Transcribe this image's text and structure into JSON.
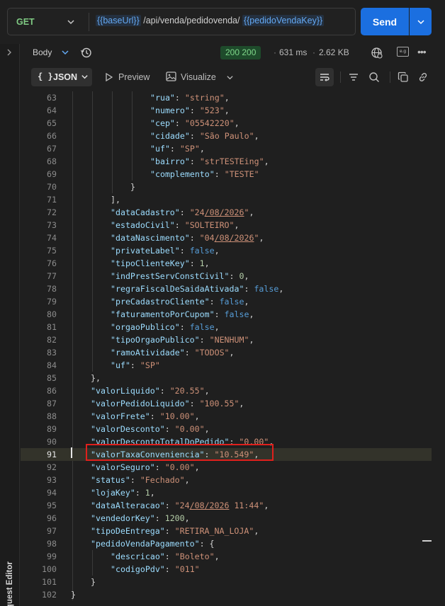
{
  "request": {
    "method": "GET",
    "url_parts": [
      {
        "text": "{{baseUrl}}",
        "type": "var"
      },
      {
        "text": " /api/venda/pedidovenda/ ",
        "type": "plain"
      },
      {
        "text": "{{pedidoVendaKey}}",
        "type": "var"
      }
    ],
    "send_label": "Send"
  },
  "sidebar": {
    "request_editor_label": "Request Editor"
  },
  "response": {
    "body_tab_label": "Body",
    "status": "200 200",
    "time": "631 ms",
    "size": "2.62 KB",
    "example_icon_text": "e.g"
  },
  "toolbar": {
    "json_brace": "{ }",
    "json_label": "JSON",
    "preview_label": "Preview",
    "visualize_label": "Visualize"
  },
  "colors": {
    "send_button": "#1b6fe0",
    "status_badge_bg": "#1e4b2b",
    "status_badge_text": "#7fd78a",
    "highlight_border": "#e0201c",
    "method": "#7fca83",
    "variable": "#64a9f4"
  },
  "icons": [
    "chevron-down-icon",
    "history-icon",
    "globe-icon",
    "example-icon",
    "more-icon",
    "play-icon",
    "image-icon",
    "wrap-icon",
    "filter-icon",
    "search-icon",
    "copy-icon",
    "link-icon",
    "chevron-right-icon"
  ],
  "code": {
    "highlighted_line": 91,
    "lines": [
      {
        "n": 63,
        "ind": 16,
        "t": [
          [
            "k",
            "\"rua\""
          ],
          [
            "p",
            ": "
          ],
          [
            "s",
            "\"string\""
          ],
          [
            "p",
            ","
          ]
        ]
      },
      {
        "n": 64,
        "ind": 16,
        "t": [
          [
            "k",
            "\"numero\""
          ],
          [
            "p",
            ": "
          ],
          [
            "s",
            "\"523\""
          ],
          [
            "p",
            ","
          ]
        ]
      },
      {
        "n": 65,
        "ind": 16,
        "t": [
          [
            "k",
            "\"cep\""
          ],
          [
            "p",
            ": "
          ],
          [
            "s",
            "\"05542220\""
          ],
          [
            "p",
            ","
          ]
        ]
      },
      {
        "n": 66,
        "ind": 16,
        "t": [
          [
            "k",
            "\"cidade\""
          ],
          [
            "p",
            ": "
          ],
          [
            "s",
            "\"São Paulo\""
          ],
          [
            "p",
            ","
          ]
        ]
      },
      {
        "n": 67,
        "ind": 16,
        "t": [
          [
            "k",
            "\"uf\""
          ],
          [
            "p",
            ": "
          ],
          [
            "s",
            "\"SP\""
          ],
          [
            "p",
            ","
          ]
        ]
      },
      {
        "n": 68,
        "ind": 16,
        "t": [
          [
            "k",
            "\"bairro\""
          ],
          [
            "p",
            ": "
          ],
          [
            "s",
            "\"strTESTEing\""
          ],
          [
            "p",
            ","
          ]
        ]
      },
      {
        "n": 69,
        "ind": 16,
        "t": [
          [
            "k",
            "\"complemento\""
          ],
          [
            "p",
            ": "
          ],
          [
            "s",
            "\"TESTE\""
          ]
        ]
      },
      {
        "n": 70,
        "ind": 12,
        "t": [
          [
            "p",
            "}"
          ]
        ]
      },
      {
        "n": 71,
        "ind": 8,
        "t": [
          [
            "p",
            "],"
          ]
        ]
      },
      {
        "n": 72,
        "ind": 8,
        "t": [
          [
            "k",
            "\"dataCadastro\""
          ],
          [
            "p",
            ": "
          ],
          [
            "s",
            "\"24"
          ],
          [
            "su",
            "/08/2026"
          ],
          [
            "s",
            "\""
          ],
          [
            "p",
            ","
          ]
        ]
      },
      {
        "n": 73,
        "ind": 8,
        "t": [
          [
            "k",
            "\"estadoCivil\""
          ],
          [
            "p",
            ": "
          ],
          [
            "s",
            "\"SOLTEIRO\""
          ],
          [
            "p",
            ","
          ]
        ]
      },
      {
        "n": 74,
        "ind": 8,
        "t": [
          [
            "k",
            "\"dataNascimento\""
          ],
          [
            "p",
            ": "
          ],
          [
            "s",
            "\"04"
          ],
          [
            "su",
            "/08/2026"
          ],
          [
            "s",
            "\""
          ],
          [
            "p",
            ","
          ]
        ]
      },
      {
        "n": 75,
        "ind": 8,
        "t": [
          [
            "k",
            "\"privateLabel\""
          ],
          [
            "p",
            ": "
          ],
          [
            "b",
            "false"
          ],
          [
            "p",
            ","
          ]
        ]
      },
      {
        "n": 76,
        "ind": 8,
        "t": [
          [
            "k",
            "\"tipoClienteKey\""
          ],
          [
            "p",
            ": "
          ],
          [
            "n",
            "1"
          ],
          [
            "p",
            ","
          ]
        ]
      },
      {
        "n": 77,
        "ind": 8,
        "t": [
          [
            "k",
            "\"indPrestServConstCivil\""
          ],
          [
            "p",
            ": "
          ],
          [
            "n",
            "0"
          ],
          [
            "p",
            ","
          ]
        ]
      },
      {
        "n": 78,
        "ind": 8,
        "t": [
          [
            "k",
            "\"regraFiscalDeSaidaAtivada\""
          ],
          [
            "p",
            ": "
          ],
          [
            "b",
            "false"
          ],
          [
            "p",
            ","
          ]
        ]
      },
      {
        "n": 79,
        "ind": 8,
        "t": [
          [
            "k",
            "\"preCadastroCliente\""
          ],
          [
            "p",
            ": "
          ],
          [
            "b",
            "false"
          ],
          [
            "p",
            ","
          ]
        ]
      },
      {
        "n": 80,
        "ind": 8,
        "t": [
          [
            "k",
            "\"faturamentoPorCupom\""
          ],
          [
            "p",
            ": "
          ],
          [
            "b",
            "false"
          ],
          [
            "p",
            ","
          ]
        ]
      },
      {
        "n": 81,
        "ind": 8,
        "t": [
          [
            "k",
            "\"orgaoPublico\""
          ],
          [
            "p",
            ": "
          ],
          [
            "b",
            "false"
          ],
          [
            "p",
            ","
          ]
        ]
      },
      {
        "n": 82,
        "ind": 8,
        "t": [
          [
            "k",
            "\"tipoOrgaoPublico\""
          ],
          [
            "p",
            ": "
          ],
          [
            "s",
            "\"NENHUM\""
          ],
          [
            "p",
            ","
          ]
        ]
      },
      {
        "n": 83,
        "ind": 8,
        "t": [
          [
            "k",
            "\"ramoAtividade\""
          ],
          [
            "p",
            ": "
          ],
          [
            "s",
            "\"TODOS\""
          ],
          [
            "p",
            ","
          ]
        ]
      },
      {
        "n": 84,
        "ind": 8,
        "t": [
          [
            "k",
            "\"uf\""
          ],
          [
            "p",
            ": "
          ],
          [
            "s",
            "\"SP\""
          ]
        ]
      },
      {
        "n": 85,
        "ind": 4,
        "t": [
          [
            "p",
            "},"
          ]
        ]
      },
      {
        "n": 86,
        "ind": 4,
        "t": [
          [
            "k",
            "\"valorLiquido\""
          ],
          [
            "p",
            ": "
          ],
          [
            "s",
            "\"20.55\""
          ],
          [
            "p",
            ","
          ]
        ]
      },
      {
        "n": 87,
        "ind": 4,
        "t": [
          [
            "k",
            "\"valorPedidoLiquido\""
          ],
          [
            "p",
            ": "
          ],
          [
            "s",
            "\"100.55\""
          ],
          [
            "p",
            ","
          ]
        ]
      },
      {
        "n": 88,
        "ind": 4,
        "t": [
          [
            "k",
            "\"valorFrete\""
          ],
          [
            "p",
            ": "
          ],
          [
            "s",
            "\"10.00\""
          ],
          [
            "p",
            ","
          ]
        ]
      },
      {
        "n": 89,
        "ind": 4,
        "t": [
          [
            "k",
            "\"valorDesconto\""
          ],
          [
            "p",
            ": "
          ],
          [
            "s",
            "\"0.00\""
          ],
          [
            "p",
            ","
          ]
        ]
      },
      {
        "n": 90,
        "ind": 4,
        "t": [
          [
            "k",
            "\"valorDescontoTotalDoPedido\""
          ],
          [
            "p",
            ": "
          ],
          [
            "s",
            "\"0.00\""
          ],
          [
            "p",
            ","
          ]
        ]
      },
      {
        "n": 91,
        "ind": 4,
        "t": [
          [
            "k",
            "\"valorTaxaConveniencia\""
          ],
          [
            "p",
            ": "
          ],
          [
            "s",
            "\"10.549\""
          ],
          [
            "p",
            ","
          ]
        ]
      },
      {
        "n": 92,
        "ind": 4,
        "t": [
          [
            "k",
            "\"valorSeguro\""
          ],
          [
            "p",
            ": "
          ],
          [
            "s",
            "\"0.00\""
          ],
          [
            "p",
            ","
          ]
        ]
      },
      {
        "n": 93,
        "ind": 4,
        "t": [
          [
            "k",
            "\"status\""
          ],
          [
            "p",
            ": "
          ],
          [
            "s",
            "\"Fechado\""
          ],
          [
            "p",
            ","
          ]
        ]
      },
      {
        "n": 94,
        "ind": 4,
        "t": [
          [
            "k",
            "\"lojaKey\""
          ],
          [
            "p",
            ": "
          ],
          [
            "n",
            "1"
          ],
          [
            "p",
            ","
          ]
        ]
      },
      {
        "n": 95,
        "ind": 4,
        "t": [
          [
            "k",
            "\"dataAlteracao\""
          ],
          [
            "p",
            ": "
          ],
          [
            "s",
            "\"24"
          ],
          [
            "su",
            "/08/2026"
          ],
          [
            "s",
            " 11:44\""
          ],
          [
            "p",
            ","
          ]
        ]
      },
      {
        "n": 96,
        "ind": 4,
        "t": [
          [
            "k",
            "\"vendedorKey\""
          ],
          [
            "p",
            ": "
          ],
          [
            "n",
            "1200"
          ],
          [
            "p",
            ","
          ]
        ]
      },
      {
        "n": 97,
        "ind": 4,
        "t": [
          [
            "k",
            "\"tipoDeEntrega\""
          ],
          [
            "p",
            ": "
          ],
          [
            "s",
            "\"RETIRA_NA_LOJA\""
          ],
          [
            "p",
            ","
          ]
        ]
      },
      {
        "n": 98,
        "ind": 4,
        "t": [
          [
            "k",
            "\"pedidoVendaPagamento\""
          ],
          [
            "p",
            ": {"
          ]
        ]
      },
      {
        "n": 99,
        "ind": 8,
        "t": [
          [
            "k",
            "\"descricao\""
          ],
          [
            "p",
            ": "
          ],
          [
            "s",
            "\"Boleto\""
          ],
          [
            "p",
            ","
          ]
        ]
      },
      {
        "n": 100,
        "ind": 8,
        "t": [
          [
            "k",
            "\"codigoPdv\""
          ],
          [
            "p",
            ": "
          ],
          [
            "s",
            "\"011\""
          ]
        ]
      },
      {
        "n": 101,
        "ind": 4,
        "t": [
          [
            "p",
            "}"
          ]
        ]
      },
      {
        "n": 102,
        "ind": 0,
        "t": [
          [
            "p",
            "}"
          ]
        ]
      }
    ]
  }
}
